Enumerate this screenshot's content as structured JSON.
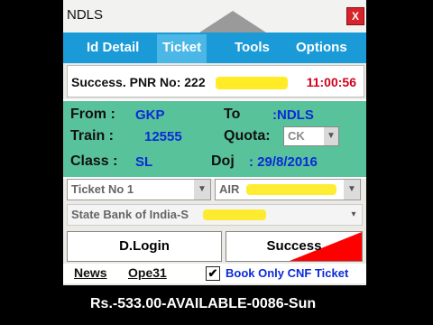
{
  "window": {
    "title": "NDLS",
    "close_glyph": "X"
  },
  "menu": [
    {
      "label": "Id Detail"
    },
    {
      "label": "Ticket"
    },
    {
      "label": "Tools"
    },
    {
      "label": "Options"
    }
  ],
  "status": {
    "pnr_text": "Success. PNR No: 222",
    "time": "11:00:56",
    "color": "#d0021b"
  },
  "journey": {
    "from_label": "From :",
    "from_value": "GKP",
    "to_label": "To",
    "to_value": ":NDLS",
    "train_label": "Train :",
    "train_value": "12555",
    "quota_label": "Quota:",
    "quota_value": "CK",
    "class_label": "Class :",
    "class_value": "SL",
    "doj_label": "Doj",
    "doj_value": ": 29/8/2016"
  },
  "selectors": {
    "ticket_no": "Ticket No 1",
    "payment_left": "AIR",
    "bank": "State Bank of India-S"
  },
  "buttons": {
    "login": "D.Login",
    "success": "Success"
  },
  "footer": {
    "news": "News",
    "ope": "Ope31",
    "check": "✔",
    "cnf_label": "Book Only CNF Ticket"
  },
  "ticker": {
    "text": "Rs.-533.00-AVAILABLE-0086-Sun"
  },
  "colors": {
    "menu_bg": "#1a9bd8",
    "info_bg": "#58c29a",
    "accent_blue": "#0a2bd8"
  }
}
